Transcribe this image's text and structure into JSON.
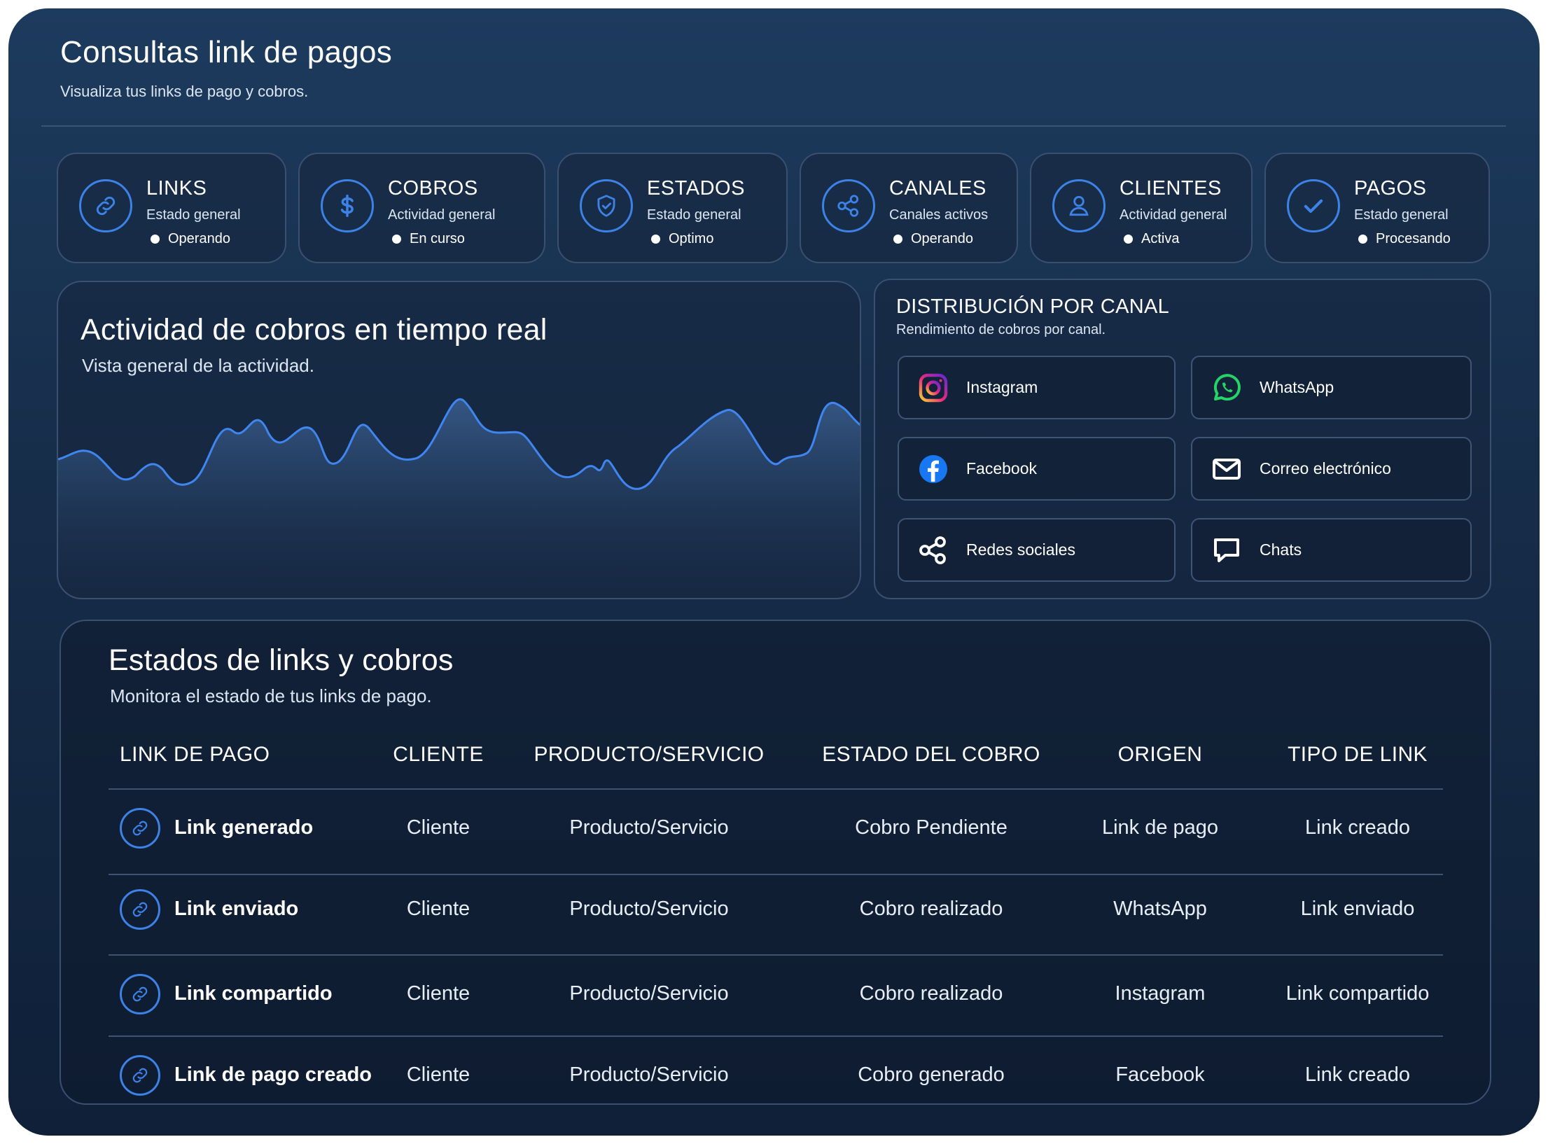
{
  "header": {
    "title": "Consultas link de pagos",
    "subtitle": "Visualiza tus links de pago y cobros."
  },
  "stats": [
    {
      "label": "LINKS",
      "desc": "Estado general",
      "status": "Operando",
      "icon": "link-icon"
    },
    {
      "label": "COBROS",
      "desc": "Actividad general",
      "status": "En curso",
      "icon": "dollar-icon"
    },
    {
      "label": "ESTADOS",
      "desc": "Estado general",
      "status": "Optimo",
      "icon": "shield-icon"
    },
    {
      "label": "CANALES",
      "desc": "Canales activos",
      "status": "Operando",
      "icon": "share-icon"
    },
    {
      "label": "CLIENTES",
      "desc": "Actividad general",
      "status": "Activa",
      "icon": "user-icon"
    },
    {
      "label": "PAGOS",
      "desc": "Estado general",
      "status": "Procesando",
      "icon": "check-icon"
    }
  ],
  "activity": {
    "title": "Actividad de cobros en tiempo real",
    "subtitle": "Vista general de la actividad.",
    "line_color": "#3f86f0"
  },
  "distribution": {
    "title": "DISTRIBUCIÓN POR CANAL",
    "subtitle": "Rendimiento de cobros por canal.",
    "channels": [
      {
        "label": "Instagram",
        "icon": "instagram-icon"
      },
      {
        "label": "WhatsApp",
        "icon": "whatsapp-icon"
      },
      {
        "label": "Facebook",
        "icon": "facebook-icon"
      },
      {
        "label": "Correo electrónico",
        "icon": "mail-icon"
      },
      {
        "label": "Redes sociales",
        "icon": "share-icon"
      },
      {
        "label": "Chats",
        "icon": "chat-icon"
      }
    ]
  },
  "table": {
    "title": "Estados de links y cobros",
    "subtitle": "Monitora el estado de tus links de pago.",
    "columns": [
      "LINK DE PAGO",
      "CLIENTE",
      "PRODUCTO/SERVICIO",
      "ESTADO DEL COBRO",
      "ORIGEN",
      "TIPO DE LINK"
    ],
    "rows": [
      [
        "Link generado",
        "Cliente",
        "Producto/Servicio",
        "Cobro Pendiente",
        "Link de pago",
        "Link creado"
      ],
      [
        "Link enviado",
        "Cliente",
        "Producto/Servicio",
        "Cobro realizado",
        "WhatsApp",
        "Link enviado"
      ],
      [
        "Link compartido",
        "Cliente",
        "Producto/Servicio",
        "Cobro realizado",
        "Instagram",
        "Link compartido"
      ],
      [
        "Link de pago creado",
        "Cliente",
        "Producto/Servicio",
        "Cobro generado",
        "Facebook",
        "Link creado"
      ]
    ]
  },
  "colors": {
    "accent": "#3d82e6",
    "background": "#162c48",
    "border": "#3a5070",
    "whatsapp": "#25d366",
    "facebook": "#1877f2"
  }
}
